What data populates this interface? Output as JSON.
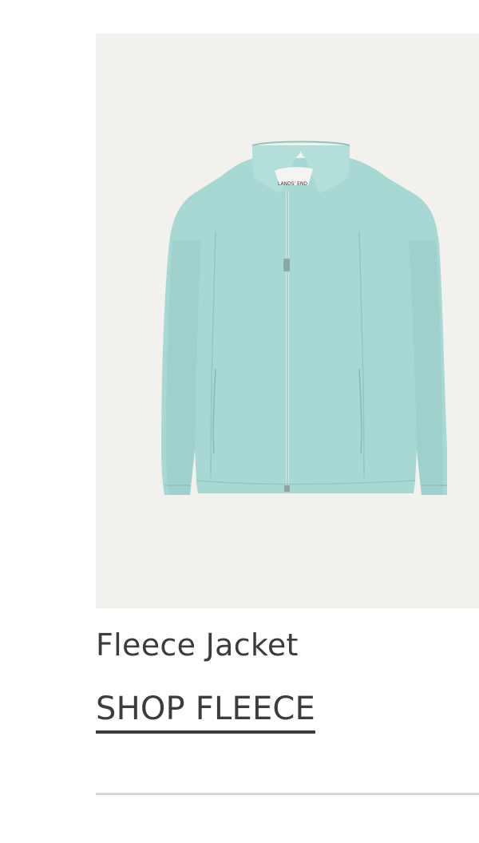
{
  "product": {
    "title": "Fleece Jacket",
    "cta_label": "SHOP FLEECE",
    "image_label": "LANDS' END",
    "image_bg_color": "#f3f1ed",
    "jacket_color": "#a8d8d3"
  },
  "colors": {
    "text": "#3c3c3e",
    "divider": "#d6d6d6"
  }
}
